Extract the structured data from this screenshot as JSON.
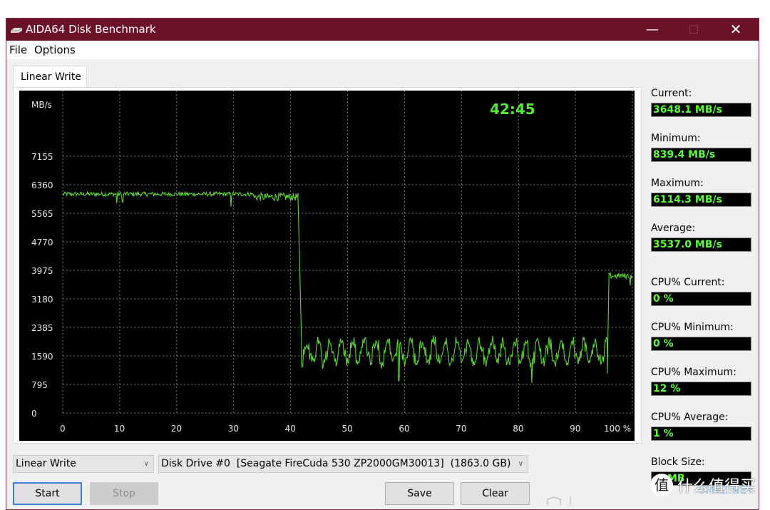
{
  "window": {
    "title": "AIDA64 Disk Benchmark",
    "controls": {
      "minimize": "—",
      "maximize": "☐",
      "close": "✕"
    }
  },
  "menu": {
    "items": [
      "File",
      "Options"
    ]
  },
  "tabs": [
    {
      "label": "Linear Write",
      "active": true
    }
  ],
  "elapsed_time": "42:45",
  "stats": {
    "current": {
      "label": "Current:",
      "value": "3648.1 MB/s"
    },
    "minimum": {
      "label": "Minimum:",
      "value": "839.4 MB/s"
    },
    "maximum": {
      "label": "Maximum:",
      "value": "6114.3 MB/s"
    },
    "average": {
      "label": "Average:",
      "value": "3537.0 MB/s"
    },
    "cpu_current": {
      "label": "CPU% Current:",
      "value": "0 %"
    },
    "cpu_minimum": {
      "label": "CPU% Minimum:",
      "value": "0 %"
    },
    "cpu_maximum": {
      "label": "CPU% Maximum:",
      "value": "12 %"
    },
    "cpu_average": {
      "label": "CPU% Average:",
      "value": "1 %"
    },
    "block_size": {
      "label": "Block Size:",
      "value": "MB"
    }
  },
  "controls": {
    "test_select": {
      "value": "Linear Write"
    },
    "drive_select": {
      "value": "Disk Drive #0  [Seagate FireCuda 530 ZP2000GM30013]  (1863.0 GB)"
    },
    "start_label": "Start",
    "stop_label": "Stop",
    "save_label": "Save",
    "clear_label": "Clear"
  },
  "watermark": {
    "text": "什么值得买",
    "sub": "SMYZ.NET",
    "badge": "值"
  },
  "colors": {
    "titlebar": "#6c1228",
    "trace": "#5fd23a",
    "value_text": "#5dff3a",
    "elapsed_text": "#55e83a"
  },
  "chart_data": {
    "type": "line",
    "title": "",
    "xlabel": "%",
    "ylabel": "MB/s",
    "xlim": [
      0,
      100
    ],
    "ylim": [
      0,
      7950
    ],
    "x_ticks": [
      "0",
      "10",
      "20",
      "30",
      "40",
      "50",
      "60",
      "70",
      "80",
      "90",
      "100 %"
    ],
    "y_ticks": [
      "0",
      "795",
      "1590",
      "2385",
      "3180",
      "3975",
      "4770",
      "5565",
      "6360",
      "7155"
    ],
    "y_tick_values": [
      0,
      795,
      1590,
      2385,
      3180,
      3975,
      4770,
      5565,
      6360,
      7155
    ],
    "grid": true,
    "series": [
      {
        "name": "Linear Write",
        "segments": [
          {
            "x_start": 0,
            "x_end": 33.5,
            "level": 6100,
            "jitter": 60,
            "dips": [
              [
                9.5,
                5850
              ],
              [
                10.5,
                5880
              ],
              [
                29.5,
                5750
              ]
            ]
          },
          {
            "x_start": 33.5,
            "x_end": 41.3,
            "level": 6020,
            "jitter": 110,
            "dips": []
          },
          {
            "x_start": 41.3,
            "x_end": 41.9,
            "level_from": 6000,
            "level_to": 2100,
            "jitter": 0,
            "dips": []
          },
          {
            "x_start": 41.9,
            "x_end": 95.6,
            "level": 1700,
            "jitter": 380,
            "dips": [
              [
                59,
                900
              ],
              [
                82.3,
                840
              ]
            ]
          },
          {
            "x_start": 95.6,
            "x_end": 95.9,
            "level_from": 1100,
            "level_to": 3850,
            "jitter": 0,
            "dips": []
          },
          {
            "x_start": 95.9,
            "x_end": 100,
            "level": 3820,
            "jitter": 80,
            "dips": [
              [
                99.6,
                3550
              ]
            ]
          }
        ]
      }
    ]
  }
}
